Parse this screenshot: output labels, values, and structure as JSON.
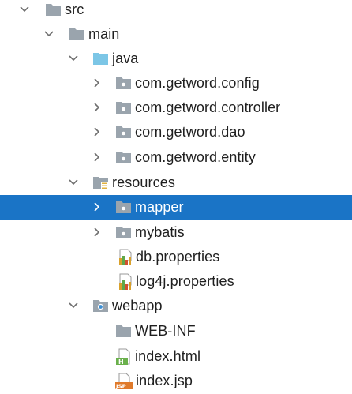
{
  "tree": {
    "items": [
      {
        "label": "src",
        "icon": "folder-icon",
        "state": "expanded"
      },
      {
        "label": "main",
        "icon": "folder-icon",
        "state": "expanded"
      },
      {
        "label": "java",
        "icon": "source-folder-icon",
        "state": "expanded"
      },
      {
        "label": "com.getword.config",
        "icon": "package-icon",
        "state": "collapsed"
      },
      {
        "label": "com.getword.controller",
        "icon": "package-icon",
        "state": "collapsed"
      },
      {
        "label": "com.getword.dao",
        "icon": "package-icon",
        "state": "collapsed"
      },
      {
        "label": "com.getword.entity",
        "icon": "package-icon",
        "state": "collapsed"
      },
      {
        "label": "resources",
        "icon": "resources-folder-icon",
        "state": "expanded"
      },
      {
        "label": "mapper",
        "icon": "package-icon",
        "state": "collapsed",
        "selected": true
      },
      {
        "label": "mybatis",
        "icon": "package-icon",
        "state": "collapsed"
      },
      {
        "label": "db.properties",
        "icon": "properties-file-icon",
        "state": "leaf"
      },
      {
        "label": "log4j.properties",
        "icon": "properties-file-icon",
        "state": "leaf"
      },
      {
        "label": "webapp",
        "icon": "web-folder-icon",
        "state": "expanded"
      },
      {
        "label": "WEB-INF",
        "icon": "folder-icon",
        "state": "leaf"
      },
      {
        "label": "index.html",
        "icon": "html-file-icon",
        "state": "leaf"
      },
      {
        "label": "index.jsp",
        "icon": "jsp-file-icon",
        "state": "leaf"
      }
    ]
  },
  "colors": {
    "selection": "#1a74c6",
    "folder": "#9aa4ad",
    "source_folder": "#7cc6e6",
    "chevron": "#6e6e6e"
  }
}
